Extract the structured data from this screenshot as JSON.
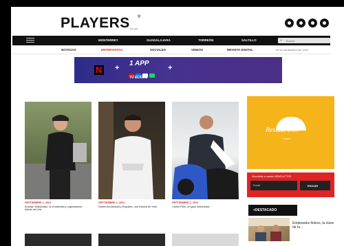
{
  "header": {
    "logo": "PLAYERS",
    "logo_sub": "OF LIFE",
    "logo_mark": "®",
    "social_icons": [
      "facebook-icon",
      "twitter-icon",
      "instagram-icon",
      "youtube-icon"
    ]
  },
  "topbar": {
    "cities": [
      "MONTERREY",
      "GUADALAJARA",
      "TORREÓN",
      "SALTILLO"
    ],
    "search": {
      "icon": "search-icon",
      "placeholder": "Buscar"
    }
  },
  "nav": {
    "items": [
      {
        "label": "NOTICIAS",
        "active": false
      },
      {
        "label": "ENTREVISTAS",
        "active": true
      },
      {
        "label": "SOCIALES",
        "active": false
      },
      {
        "label": "VIDEOS",
        "active": false
      },
      {
        "label": "REVISTA DIGITAL",
        "active": false
      }
    ],
    "date": "05 de septiembre del 2022"
  },
  "banner": {
    "title": "1 APP",
    "plus": "+",
    "subtitle": "TÚ ELIGES",
    "colors": {
      "start": "#2e2c8a",
      "end": "#4a2f86",
      "netflix": "#e50914"
    }
  },
  "cards": [
    {
      "date": "SEPTIEMBRE 1, 2022",
      "title": "Anaclyn Maldonado, la creatividad y organización detrás del chic"
    },
    {
      "date": "SEPTIEMBRE 1, 2022",
      "title": "Daniel Arocaestad y Esquites, una historia de éxito"
    },
    {
      "date": "SEPTIEMBRE 1, 2022",
      "title": "Carlos Félix, un gato motorizado"
    }
  ],
  "sidebar": {
    "promo": {
      "logo": "Restaurants",
      "sub": "LAYERS",
      "color": "#f4b41a"
    },
    "newsletter": {
      "label": "Suscríbete a nuestro NEWSLETTER",
      "placeholder": "Email",
      "button": "ENVIAR",
      "color": "#e02424"
    },
    "destacado": {
      "label": "+DESTACADO",
      "title": "Empleados felices, la clave de tu..."
    }
  },
  "accent_color": "#e02424"
}
